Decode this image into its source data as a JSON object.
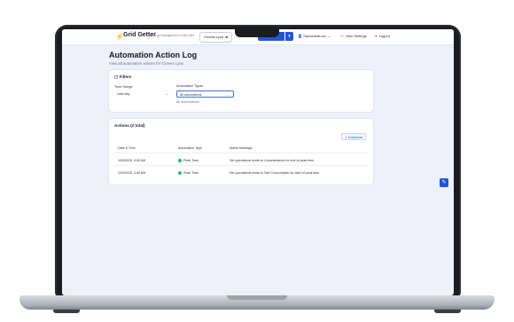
{
  "app": {
    "brand_name": "Grid Getter",
    "brand_subtitle": "Energy Management Suite (Bet",
    "store_selector": "Clovers Lynn"
  },
  "nav": {
    "user": "SamanthaLow",
    "user_settings": "User Settings",
    "logout": "Logout"
  },
  "page": {
    "title": "Automation Action Log",
    "subtitle": "View all automation actions for Clovers Lynn"
  },
  "filters": {
    "title": "Filters",
    "time_range_label": "Time Range",
    "time_range_value": "Last day",
    "automation_types_label": "Automation Types",
    "automation_types_value": "All automations",
    "automation_types_hint": "All automations"
  },
  "actions": {
    "title": "Actions (2 total)",
    "export_label": "Download",
    "columns": [
      "Date & Time",
      "Automation Type",
      "Action Message"
    ],
    "rows": [
      {
        "datetime": "10/9/2025, 9:00 AM",
        "type": "Peak Time",
        "message": "Set operational mode to Unconstrained for end of peak time"
      },
      {
        "datetime": "10/9/2025, 4:55 AM",
        "type": "Peak Time",
        "message": "Set operational mode to Self Consumption for start of peak time"
      }
    ]
  },
  "colors": {
    "accent": "#1f56d8",
    "page_bg": "#eef1fb",
    "status_dot": "#2fb67a",
    "brand_icon": "#f0b400"
  }
}
